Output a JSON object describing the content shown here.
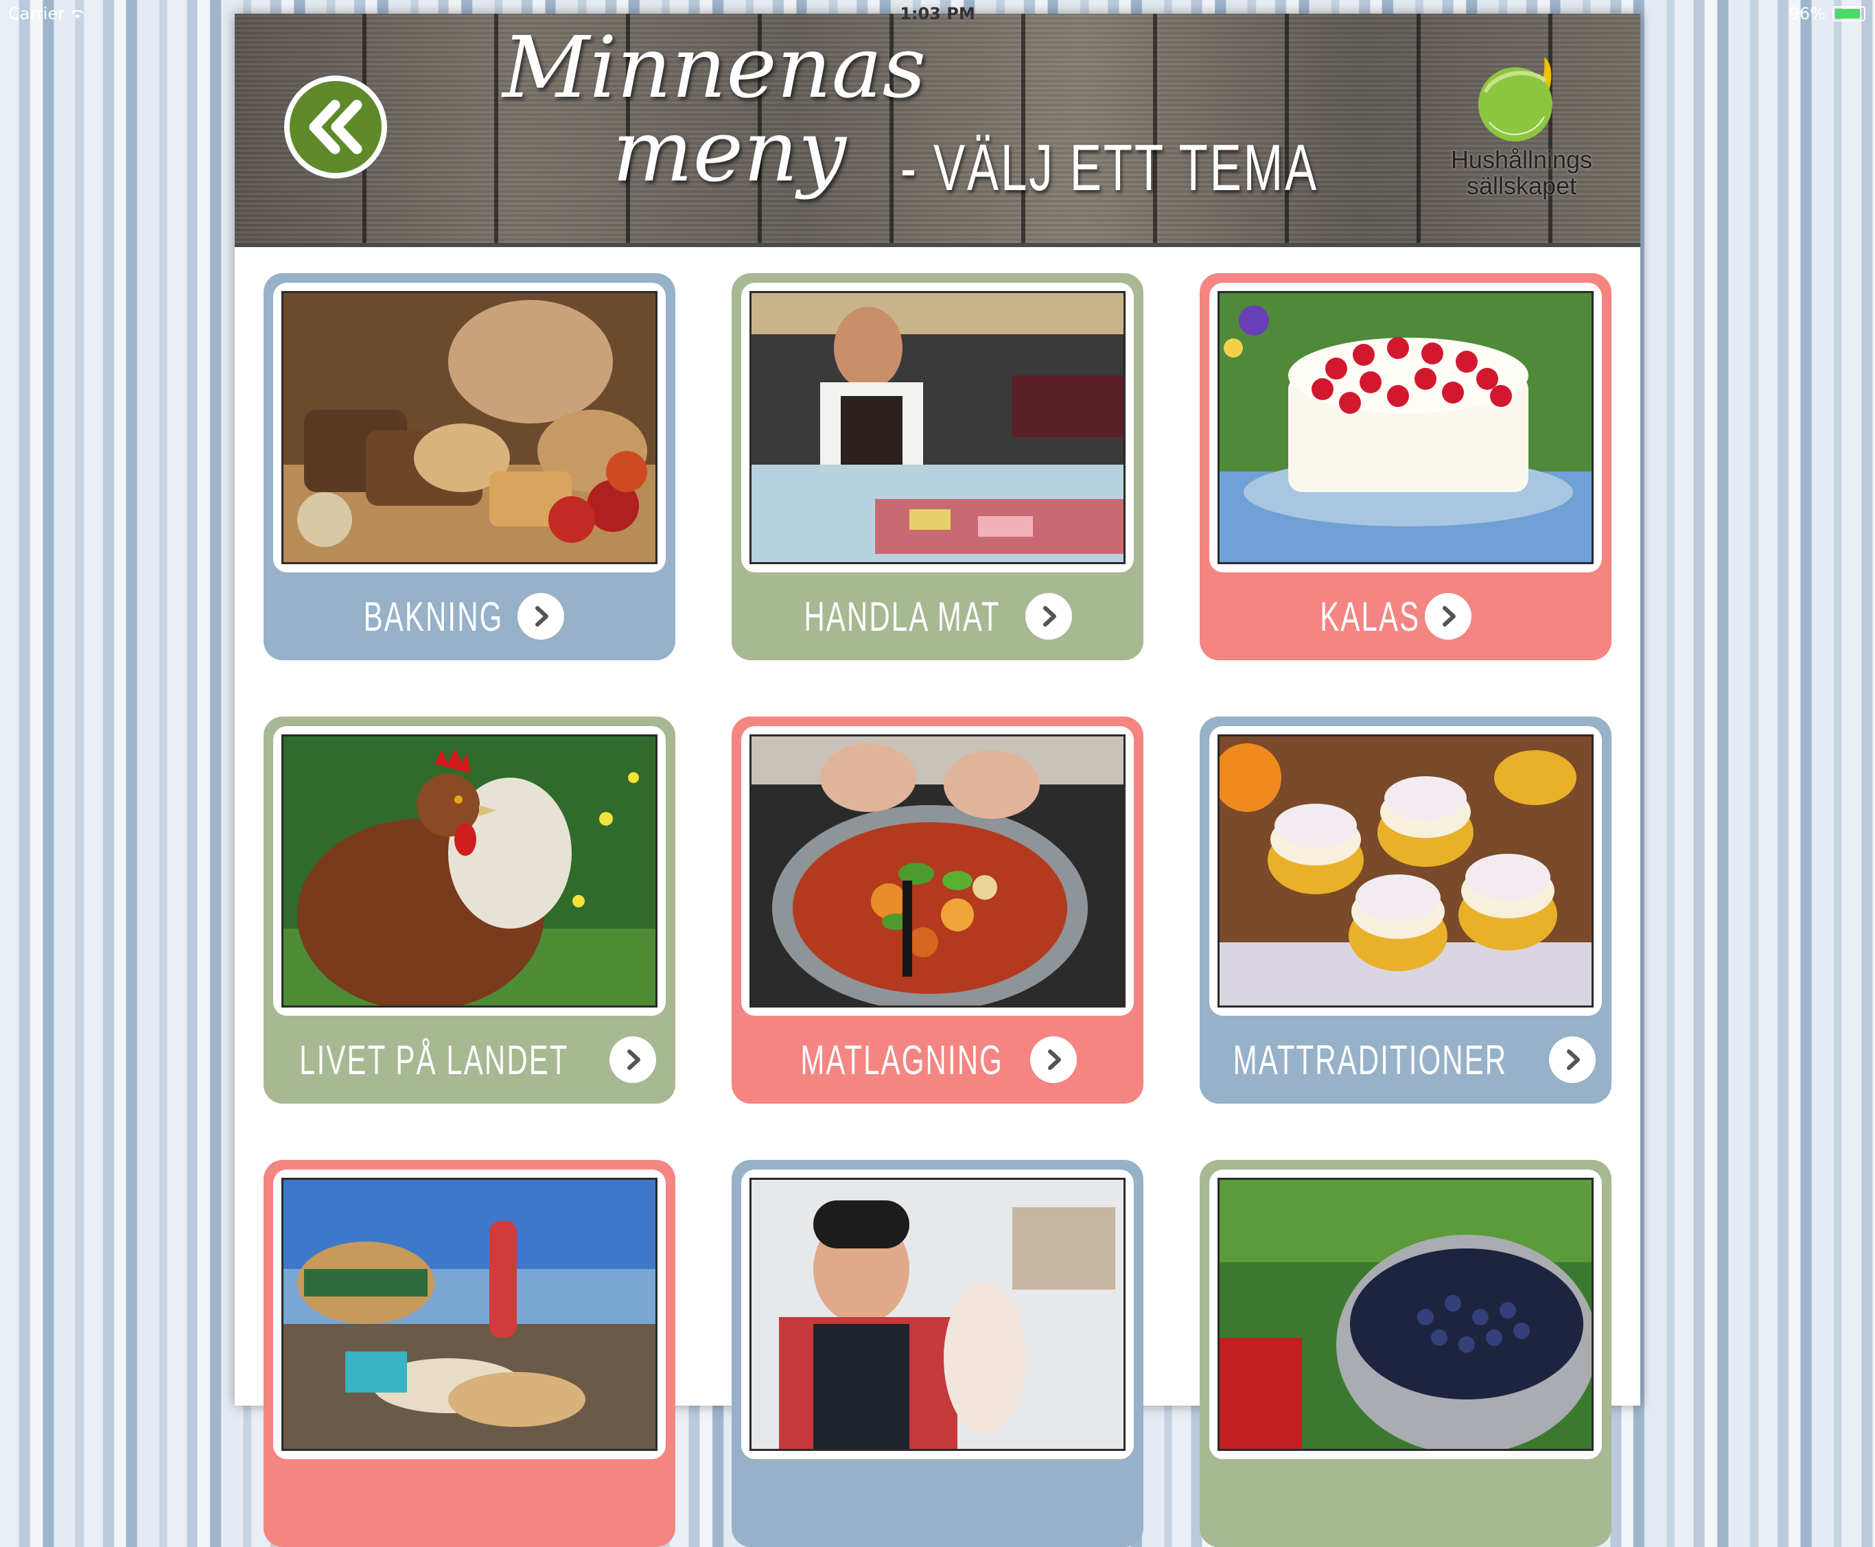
{
  "status_bar": {
    "carrier": "Carrier",
    "time": "1:03 PM",
    "battery_percent": "96%",
    "battery_level": 0.96,
    "battery_color": "#4cd964"
  },
  "header": {
    "title_script_line1": "Minnenas",
    "title_script_line2": "meny",
    "title_caps": "- VÄLJ ETT TEMA",
    "back_icon": "double-chevron-left-icon",
    "logo": {
      "line1": "Hushållnings",
      "line2": "sällskapet",
      "arc_text": "HUSHÅLLNINGSSÄLLSKAPET"
    }
  },
  "colors": {
    "blue": "#96b1c8",
    "green": "#a7b892",
    "pink": "#f48582",
    "back_button_green": "#5e8a2a"
  },
  "themes": [
    {
      "label": "BAKNING",
      "color": "blue",
      "photo": "bread-photo"
    },
    {
      "label": "HANDLA MAT",
      "color": "green",
      "photo": "butcher-photo"
    },
    {
      "label": "KALAS",
      "color": "pink",
      "photo": "strawberry-cake-photo"
    },
    {
      "label": "LIVET PÅ LANDET",
      "color": "green",
      "photo": "hen-photo"
    },
    {
      "label": "MATLAGNING",
      "color": "pink",
      "photo": "cooking-pot-photo"
    },
    {
      "label": "MATTRADITIONER",
      "color": "blue",
      "photo": "semlor-photo"
    },
    {
      "label": "",
      "color": "pink",
      "photo": "picnic-photo"
    },
    {
      "label": "",
      "color": "blue",
      "photo": "fishmonger-photo"
    },
    {
      "label": "",
      "color": "green",
      "photo": "blueberries-photo"
    }
  ]
}
